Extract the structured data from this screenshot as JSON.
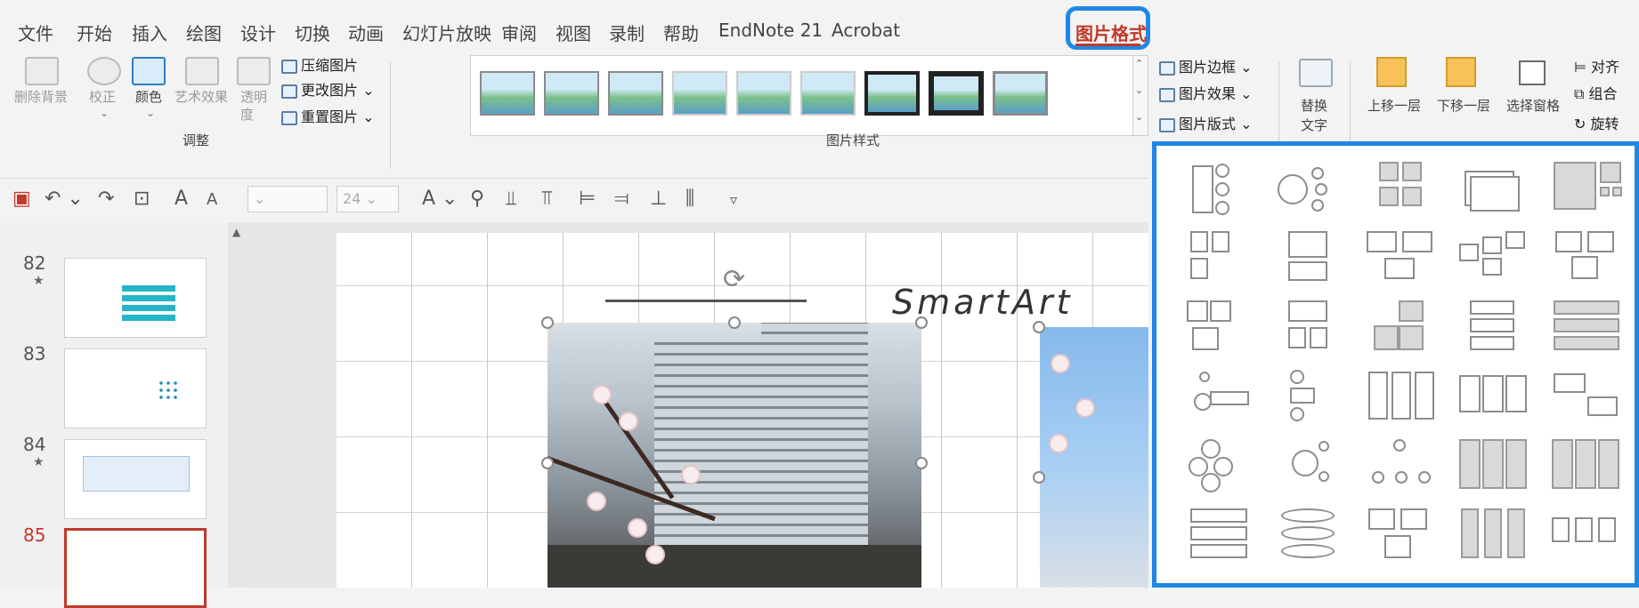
{
  "tabs": [
    "文件",
    "开始",
    "插入",
    "绘图",
    "设计",
    "切换",
    "动画",
    "幻灯片放映",
    "审阅",
    "视图",
    "录制",
    "帮助",
    "EndNote 21",
    "Acrobat"
  ],
  "active_tab": "图片格式",
  "ribbon": {
    "remove_bg": "删除背景",
    "corrections": "校正",
    "color": "颜色",
    "artistic": "艺术效果",
    "transparency_1": "透明",
    "transparency_2": "度",
    "compress": "压缩图片",
    "change": "更改图片",
    "reset": "重置图片",
    "group_adjust": "调整",
    "group_styles": "图片样式",
    "border": "图片边框",
    "effects": "图片效果",
    "layout": "图片版式",
    "alt_text_1": "替换",
    "alt_text_2": "文字",
    "bring_forward": "上移一层",
    "send_backward": "下移一层",
    "selection_pane": "选择窗格",
    "align": "对齐",
    "group": "组合",
    "rotate": "旋转"
  },
  "qat": {
    "font_size": "24"
  },
  "slides": [
    {
      "num": "82"
    },
    {
      "num": "83"
    },
    {
      "num": "84"
    },
    {
      "num": "85"
    }
  ],
  "slide": {
    "title": "SmartArt"
  },
  "layout_panel": {
    "name": "picture-layout-gallery"
  }
}
